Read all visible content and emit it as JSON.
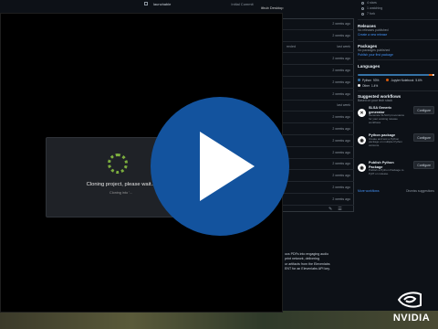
{
  "top_bar": {
    "folder": "launchable",
    "commit": "Initial Commit",
    "desktop_label": "ithub Desktop"
  },
  "files": {
    "rows": [
      {
        "name": "",
        "time": "2 weeks ago"
      },
      {
        "name": "",
        "time": "2 weeks ago"
      },
      {
        "name": "rrrcled",
        "time": "last week"
      },
      {
        "name": "",
        "time": "2 weeks ago"
      },
      {
        "name": "",
        "time": "2 weeks ago"
      },
      {
        "name": "",
        "time": "2 weeks ago"
      },
      {
        "name": "",
        "time": "2 weeks ago"
      },
      {
        "name": "",
        "time": "last week"
      },
      {
        "name": "",
        "time": "2 weeks ago"
      },
      {
        "name": "",
        "time": "2 weeks ago"
      },
      {
        "name": "",
        "time": "2 weeks ago"
      },
      {
        "name": "",
        "time": "2 weeks ago"
      },
      {
        "name": "",
        "time": "2 weeks ago"
      },
      {
        "name": "",
        "time": "2 weeks ago"
      },
      {
        "name": "",
        "time": "2 weeks ago"
      },
      {
        "name": "",
        "time": "2 weeks ago"
      }
    ]
  },
  "readme": {
    "lines": [
      "ocs PDFs into engaging audio",
      "print network, delivering",
      "",
      "ur artifacts from the Elevenlabs",
      "ENT for an Elevenlabs API key."
    ]
  },
  "sidebar": {
    "stats": [
      "4 stars",
      "1 watching",
      "7 fork"
    ],
    "releases": {
      "title": "Releases",
      "desc": "No releases published",
      "link": "Create a new release"
    },
    "packages": {
      "title": "Packages",
      "desc": "No packages published",
      "link": "Publish your first package"
    },
    "languages": {
      "title": "Languages",
      "items": [
        {
          "name": "Python",
          "pct": "93%",
          "color": "#3572a5"
        },
        {
          "name": "Jupyter Notebook",
          "pct": "5.6%",
          "color": "#da5b0b"
        },
        {
          "name": "Other",
          "pct": "1.4%",
          "color": "#ededed"
        }
      ]
    },
    "workflows": {
      "title": "Suggested workflows",
      "subtitle": "Based on your tech stack",
      "items": [
        {
          "title": "SLSA Generic generator",
          "desc": "Generate SLSA3 provenance for your existing release workflows",
          "button": "Configure"
        },
        {
          "title": "Python package",
          "desc": "Create and test a Python package on multiple Python versions.",
          "button": "Configure"
        },
        {
          "title": "Publish Python Package",
          "desc": "Publish a Python Package to PyPI on release.",
          "button": "Configure"
        }
      ],
      "more": "More workflows",
      "dismiss": "Dismiss suggestions"
    }
  },
  "clone_dialog": {
    "title": "Cloning project, please wait...",
    "subtitle": "Cloning into '...",
    "spinner_color": "#7cae3e"
  },
  "video": {
    "play_color": "#13539e"
  },
  "brand": {
    "logo_text": "NVIDIA"
  }
}
